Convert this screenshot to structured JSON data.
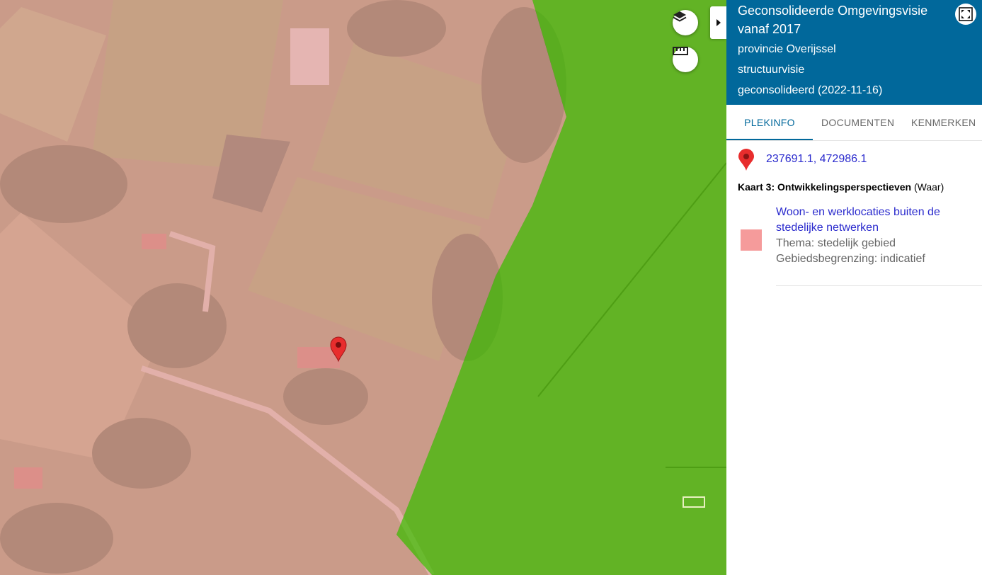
{
  "map": {
    "marker_color": "#e82d2d",
    "overlay_pink": "#f2a7a7",
    "overlay_green": "#5cb81e",
    "layers_icon": "layers-icon",
    "measure_icon": "ruler-icon",
    "collapse_icon": "caret-right-icon"
  },
  "panel": {
    "title": "Geconsolideerde Omgevingsvisie vanaf 2017",
    "authority": "provincie Overijssel",
    "type": "structuurvisie",
    "status": "geconsolideerd (2022-11-16)",
    "header_color": "#01689b",
    "fullscreen_icon": "fullscreen-icon",
    "tabs": [
      {
        "label": "PLEKINFO",
        "active": true
      },
      {
        "label": "DOCUMENTEN",
        "active": false
      },
      {
        "label": "KENMERKEN",
        "active": false
      }
    ],
    "coordinates": "237691.1, 472986.1",
    "kaart_bold": "Kaart 3: Ontwikkelingsperspectieven",
    "kaart_suffix": " (Waar)",
    "legend": {
      "swatch_color": "#f59b9b",
      "name": "Woon- en werklocaties buiten de stedelijke netwerken",
      "thema": "Thema: stedelijk gebied",
      "begrenzing": "Gebiedsbegrenzing: indicatief"
    }
  }
}
